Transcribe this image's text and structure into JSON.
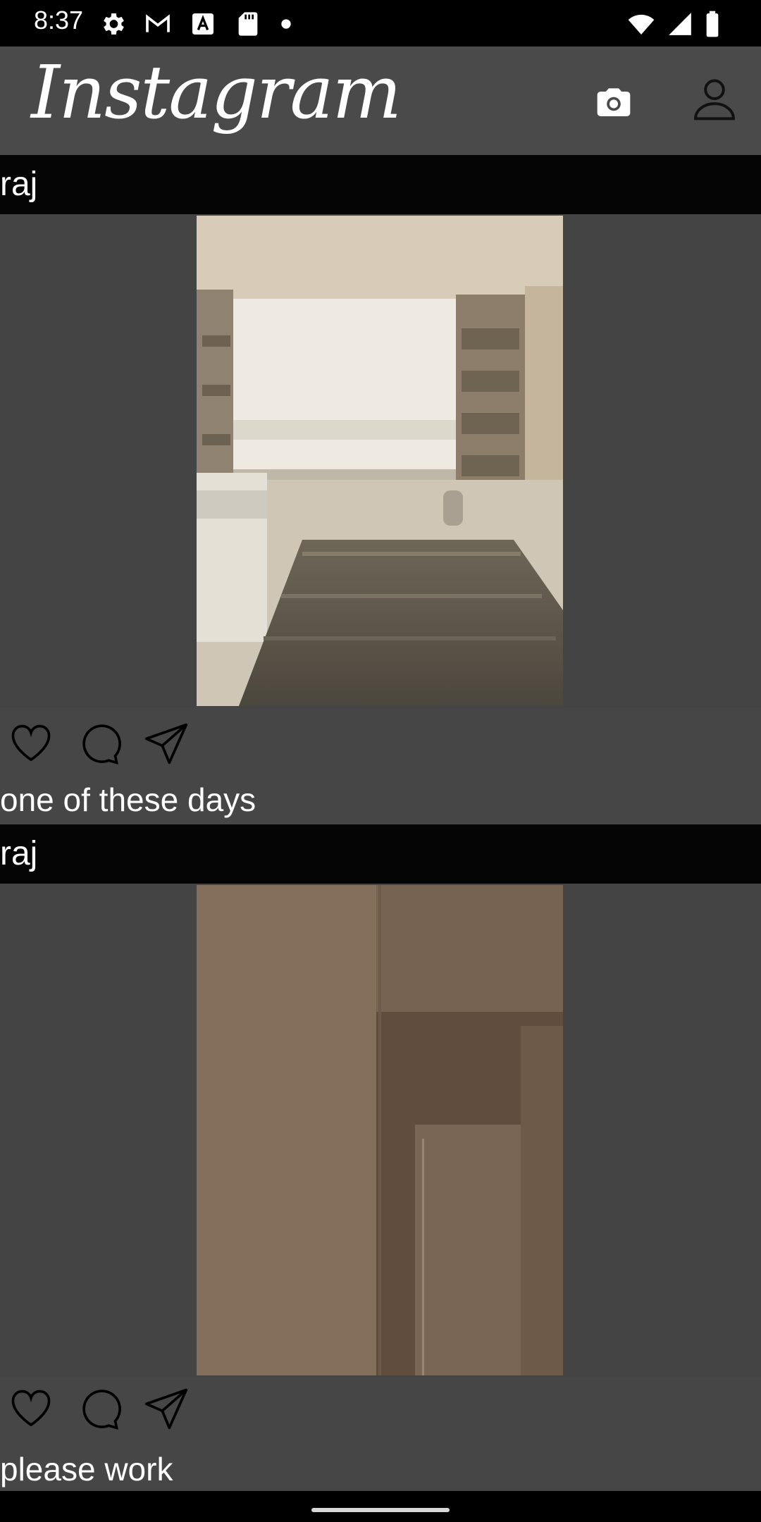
{
  "status_bar": {
    "time": "8:37",
    "left_icons": [
      "settings-gear-icon",
      "gmail-icon",
      "a-badge-icon",
      "sd-card-icon",
      "dot-icon"
    ],
    "right_icons": [
      "wifi-icon",
      "cellular-signal-icon",
      "battery-icon"
    ]
  },
  "app_bar": {
    "title": "Instagram",
    "actions": [
      "camera-icon",
      "profile-icon"
    ]
  },
  "posts": [
    {
      "username": "raj",
      "caption": "one of these days",
      "actions": [
        "heart-icon",
        "comment-icon",
        "send-icon"
      ]
    },
    {
      "username": "raj",
      "caption": "please work",
      "actions": [
        "heart-icon",
        "comment-icon",
        "send-icon"
      ]
    }
  ],
  "colors": {
    "status_bar_bg": "#000000",
    "app_bar_bg": "#4a4a4a",
    "post_header_bg": "#050505",
    "feed_bg": "#464646",
    "text": "#ffffff"
  }
}
